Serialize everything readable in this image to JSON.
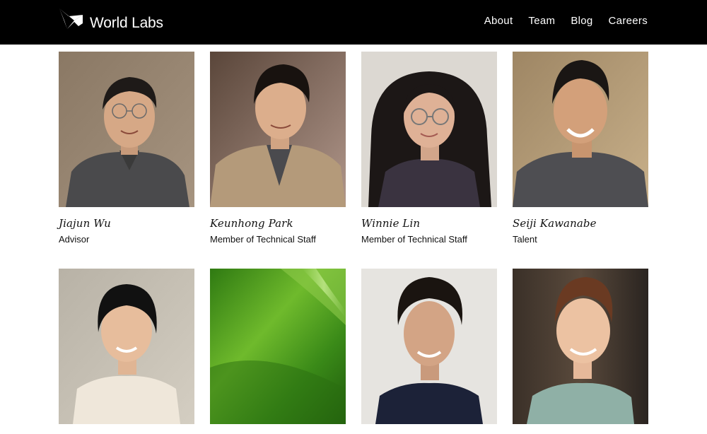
{
  "header": {
    "logo_text": "World Labs",
    "nav": [
      "About",
      "Team",
      "Blog",
      "Careers"
    ]
  },
  "team": [
    {
      "name": "Jiajun Wu",
      "role": "Advisor",
      "photo": "portrait-man-glasses"
    },
    {
      "name": "Keunhong Park",
      "role": "Member of Technical Staff",
      "photo": "portrait-man-jacket"
    },
    {
      "name": "Winnie Lin",
      "role": "Member of Technical Staff",
      "photo": "portrait-woman-glasses"
    },
    {
      "name": "Seiji Kawanabe",
      "role": "Talent",
      "photo": "portrait-man-sweater"
    },
    {
      "name": "",
      "role": "",
      "photo": "portrait-young-man"
    },
    {
      "name": "",
      "role": "",
      "photo": "green-abstract"
    },
    {
      "name": "",
      "role": "",
      "photo": "portrait-man-curly-hair"
    },
    {
      "name": "",
      "role": "",
      "photo": "portrait-man-smiling"
    }
  ],
  "colors": {
    "header_bg": "#000000",
    "page_bg": "#ffffff",
    "text": "#111111"
  }
}
